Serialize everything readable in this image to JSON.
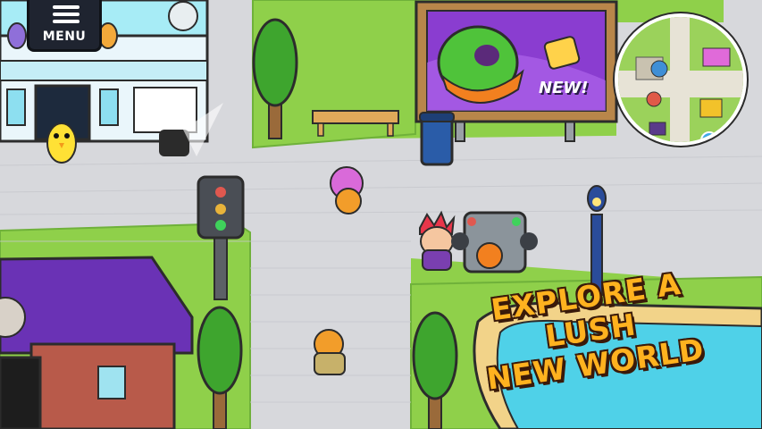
{
  "hud": {
    "menu_label": "MENU",
    "menu_icon": "hamburger-icon"
  },
  "billboard": {
    "badge_text": "NEW!"
  },
  "minimap": {
    "alert_icon": "exclamation-icon"
  },
  "promo": {
    "line1": "EXPLORE A LUSH",
    "line2": "NEW WORLD"
  },
  "colors": {
    "grass": "#8fd04a",
    "pavement": "#d7d8dc",
    "billboard_bg": "#8a3dd0",
    "promo_text": "#ffb21f",
    "roof": "#6a32b5",
    "water": "#4fd1e8"
  }
}
